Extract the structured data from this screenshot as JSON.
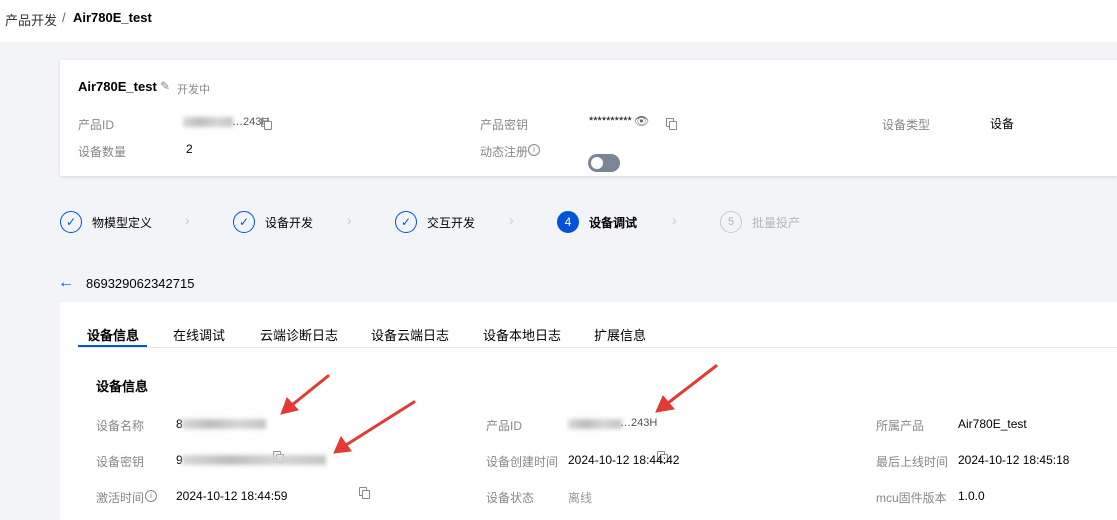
{
  "breadcrumb": {
    "parent": "产品开发",
    "separator": "/",
    "current": "Air780E_test"
  },
  "product": {
    "name": "Air780E_test",
    "status": "开发中",
    "id_label": "产品ID",
    "id_value_suffix": "…243H",
    "secret_label": "产品密钥",
    "secret_value": "**********",
    "type_label": "设备类型",
    "type_value": "设备",
    "count_label": "设备数量",
    "count_value": "2",
    "dynamic_reg_label": "动态注册",
    "dynamic_reg_enabled": false
  },
  "steps": [
    {
      "num": "1",
      "label": "物模型定义",
      "state": "done"
    },
    {
      "num": "2",
      "label": "设备开发",
      "state": "done"
    },
    {
      "num": "3",
      "label": "交互开发",
      "state": "done"
    },
    {
      "num": "4",
      "label": "设备调试",
      "state": "active"
    },
    {
      "num": "5",
      "label": "批量投产",
      "state": "pending"
    }
  ],
  "device_id": "869329062342715",
  "tabs": [
    "设备信息",
    "在线调试",
    "云端诊断日志",
    "设备云端日志",
    "设备本地日志",
    "扩展信息"
  ],
  "active_tab": "设备信息",
  "device_info": {
    "section_title": "设备信息",
    "name_label": "设备名称",
    "name_value_prefix": "8",
    "secret_label": "设备密钥",
    "secret_value_prefix": "9",
    "activated_label": "激活时间",
    "activated_value": "2024-10-12 18:44:59",
    "product_id_label": "产品ID",
    "product_id_value_suffix": "…243H",
    "created_label": "设备创建时间",
    "created_value": "2024-10-12 18:44:42",
    "status_label": "设备状态",
    "status_value": "离线",
    "product_label": "所属产品",
    "product_value": "Air780E_test",
    "last_online_label": "最后上线时间",
    "last_online_value": "2024-10-12 18:45:18",
    "mcu_label": "mcu固件版本",
    "mcu_value": "1.0.0"
  },
  "colors": {
    "primary": "#0052d9",
    "annotation_arrow": "#e53935",
    "muted": "#888888"
  }
}
